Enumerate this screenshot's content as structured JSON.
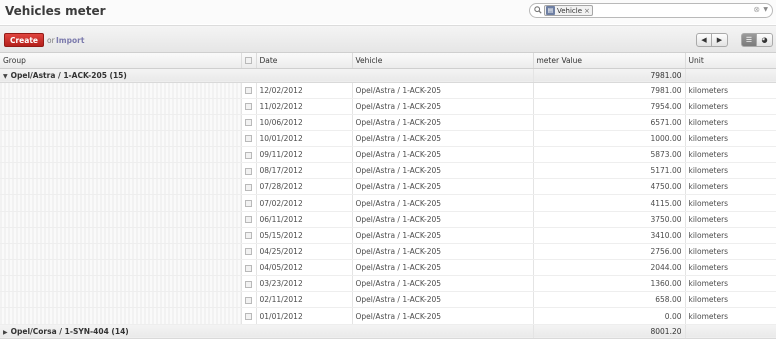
{
  "page": {
    "title": "Vehicles meter"
  },
  "search": {
    "facet_label": "Vehicle",
    "facet_remove": "×",
    "clear": "⊗",
    "dropdown": "▼"
  },
  "toolbar": {
    "create_label": "Create",
    "or_text": "or",
    "import_label": "Import",
    "prev": "◀",
    "next": "▶",
    "list_view": "☰",
    "graph_view": "◕"
  },
  "columns": {
    "group": "Group",
    "date": "Date",
    "vehicle": "Vehicle",
    "value": "meter Value",
    "unit": "Unit"
  },
  "groups": [
    {
      "name": "Opel/Astra / 1-ACK-205 (15)",
      "expanded": true,
      "toggle": "▼",
      "total": "7981.00",
      "rows": [
        {
          "date": "12/02/2012",
          "vehicle": "Opel/Astra / 1-ACK-205",
          "value": "7981.00",
          "unit": "kilometers"
        },
        {
          "date": "11/02/2012",
          "vehicle": "Opel/Astra / 1-ACK-205",
          "value": "7954.00",
          "unit": "kilometers"
        },
        {
          "date": "10/06/2012",
          "vehicle": "Opel/Astra / 1-ACK-205",
          "value": "6571.00",
          "unit": "kilometers"
        },
        {
          "date": "10/01/2012",
          "vehicle": "Opel/Astra / 1-ACK-205",
          "value": "1000.00",
          "unit": "kilometers"
        },
        {
          "date": "09/11/2012",
          "vehicle": "Opel/Astra / 1-ACK-205",
          "value": "5873.00",
          "unit": "kilometers"
        },
        {
          "date": "08/17/2012",
          "vehicle": "Opel/Astra / 1-ACK-205",
          "value": "5171.00",
          "unit": "kilometers"
        },
        {
          "date": "07/28/2012",
          "vehicle": "Opel/Astra / 1-ACK-205",
          "value": "4750.00",
          "unit": "kilometers"
        },
        {
          "date": "07/02/2012",
          "vehicle": "Opel/Astra / 1-ACK-205",
          "value": "4115.00",
          "unit": "kilometers"
        },
        {
          "date": "06/11/2012",
          "vehicle": "Opel/Astra / 1-ACK-205",
          "value": "3750.00",
          "unit": "kilometers"
        },
        {
          "date": "05/15/2012",
          "vehicle": "Opel/Astra / 1-ACK-205",
          "value": "3410.00",
          "unit": "kilometers"
        },
        {
          "date": "04/25/2012",
          "vehicle": "Opel/Astra / 1-ACK-205",
          "value": "2756.00",
          "unit": "kilometers"
        },
        {
          "date": "04/05/2012",
          "vehicle": "Opel/Astra / 1-ACK-205",
          "value": "2044.00",
          "unit": "kilometers"
        },
        {
          "date": "03/23/2012",
          "vehicle": "Opel/Astra / 1-ACK-205",
          "value": "1360.00",
          "unit": "kilometers"
        },
        {
          "date": "02/11/2012",
          "vehicle": "Opel/Astra / 1-ACK-205",
          "value": "658.00",
          "unit": "kilometers"
        },
        {
          "date": "01/01/2012",
          "vehicle": "Opel/Astra / 1-ACK-205",
          "value": "0.00",
          "unit": "kilometers"
        }
      ]
    },
    {
      "name": "Opel/Corsa / 1-SYN-404 (14)",
      "expanded": false,
      "toggle": "▶",
      "total": "8001.20",
      "rows": []
    }
  ]
}
